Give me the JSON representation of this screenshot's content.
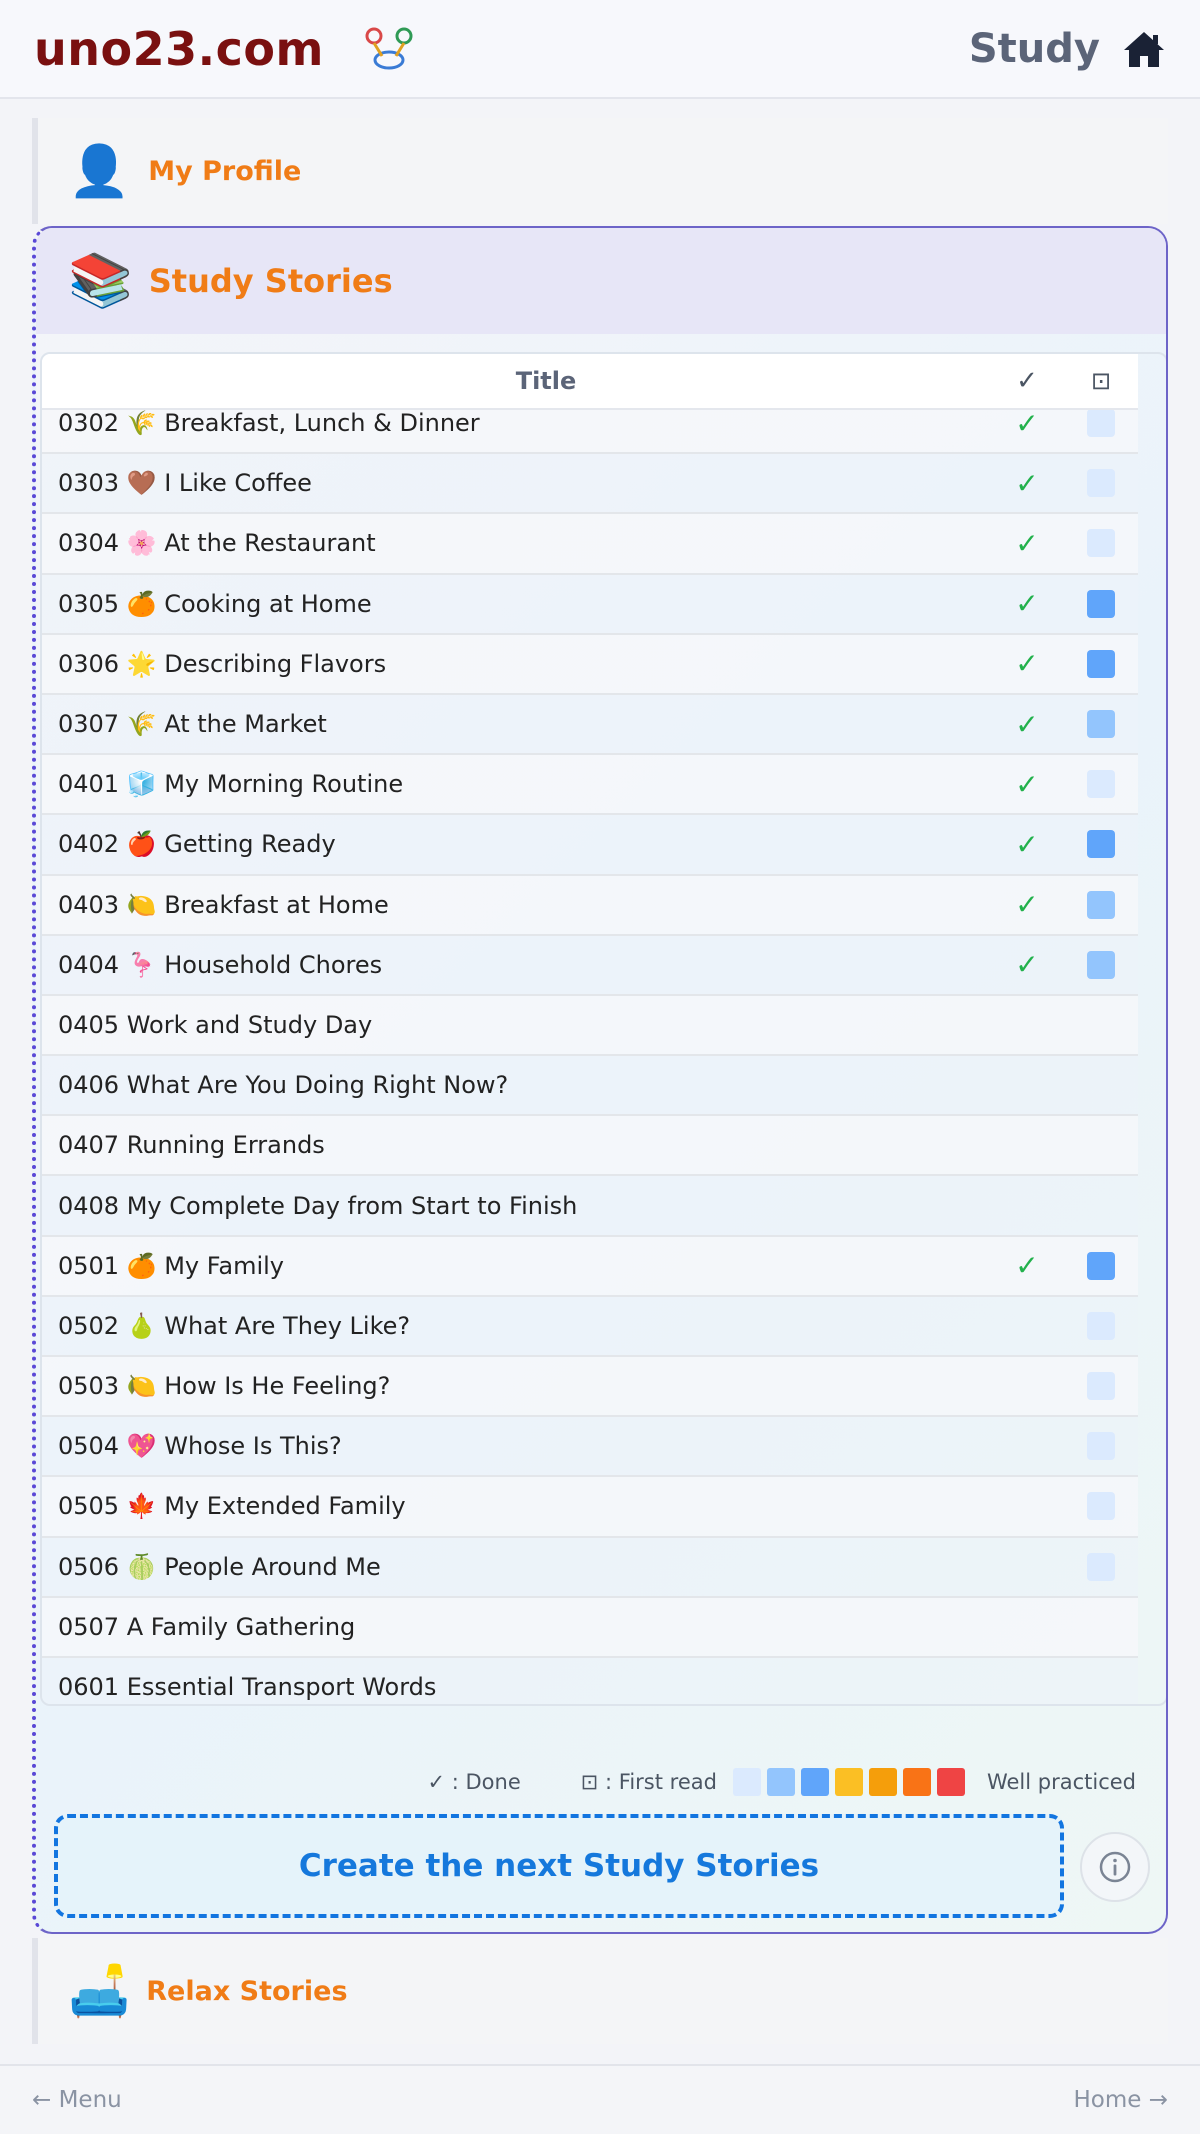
{
  "header": {
    "brand": "uno23.com",
    "nav_title": "Study"
  },
  "profile": {
    "icon": "👤",
    "label": "My Profile"
  },
  "study": {
    "icon": "📚",
    "label": "Study Stories",
    "table": {
      "col_title": "Title",
      "col_done": "✓",
      "col_first_read": "⊡"
    },
    "rows": [
      {
        "title": "0302 🌾 Breakfast, Lunch & Dinner",
        "done": "✓",
        "level": 1
      },
      {
        "title": "0303 🤎 I Like Coffee",
        "done": "✓",
        "level": 1
      },
      {
        "title": "0304 🌸 At the Restaurant",
        "done": "✓",
        "level": 1
      },
      {
        "title": "0305 🍊 Cooking at Home",
        "done": "✓",
        "level": 3
      },
      {
        "title": "0306 🌟 Describing Flavors",
        "done": "✓",
        "level": 3
      },
      {
        "title": "0307 🌾 At the Market",
        "done": "✓",
        "level": 2
      },
      {
        "title": "0401 🧊 My Morning Routine",
        "done": "✓",
        "level": 1
      },
      {
        "title": "0402 🍎 Getting Ready",
        "done": "✓",
        "level": 3
      },
      {
        "title": "0403 🍋 Breakfast at Home",
        "done": "✓",
        "level": 2
      },
      {
        "title": "0404 🦩 Household Chores",
        "done": "✓",
        "level": 2
      },
      {
        "title": "0405 Work and Study Day",
        "done": "",
        "level": 0
      },
      {
        "title": "0406 What Are You Doing Right Now?",
        "done": "",
        "level": 0
      },
      {
        "title": "0407 Running Errands",
        "done": "",
        "level": 0
      },
      {
        "title": "0408 My Complete Day from Start to Finish",
        "done": "",
        "level": 0
      },
      {
        "title": "0501 🍊 My Family",
        "done": "✓",
        "level": 3
      },
      {
        "title": "0502 🍐 What Are They Like?",
        "done": "",
        "level": 1
      },
      {
        "title": "0503 🍋 How Is He Feeling?",
        "done": "",
        "level": 1
      },
      {
        "title": "0504 💖 Whose Is This?",
        "done": "",
        "level": 1
      },
      {
        "title": "0505 🍁 My Extended Family",
        "done": "",
        "level": 1
      },
      {
        "title": "0506 🍈 People Around Me",
        "done": "",
        "level": 1
      },
      {
        "title": "0507 A Family Gathering",
        "done": "",
        "level": 0
      },
      {
        "title": "0601 Essential Transport Words",
        "done": "",
        "level": 0
      }
    ],
    "legend": {
      "done_label": "✓ : Done",
      "first_read_label": "⊡ : First read",
      "end_label": "Well practiced",
      "scale_colors": [
        "#dbeafe",
        "#93c5fd",
        "#60a5fa",
        "#fbbf24",
        "#f59e0b",
        "#f97316",
        "#ef4444"
      ]
    },
    "level_colors": [
      "transparent",
      "#dbeafe",
      "#93c5fd",
      "#60a5fa"
    ],
    "create_label": "Create the next Study Stories",
    "info_icon": "info-icon"
  },
  "relax": {
    "icon": "🛋️",
    "label": "Relax Stories"
  },
  "footer": {
    "left": "← Menu",
    "right": "Home →"
  },
  "colors": {
    "brand": "#7a1010",
    "accent_orange": "#f07c16",
    "create_blue": "#1578dc",
    "done_green": "#22b14c"
  }
}
